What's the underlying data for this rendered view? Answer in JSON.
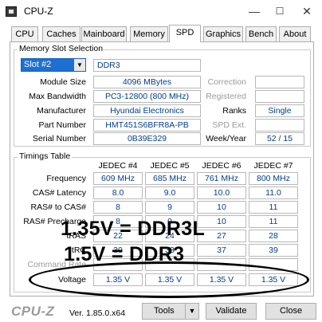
{
  "window": {
    "title": "CPU-Z",
    "minimize_glyph": "—",
    "maximize_glyph": "☐",
    "close_glyph": "✕"
  },
  "tabs": [
    {
      "label": "CPU"
    },
    {
      "label": "Caches"
    },
    {
      "label": "Mainboard"
    },
    {
      "label": "Memory"
    },
    {
      "label": "SPD",
      "active": true
    },
    {
      "label": "Graphics"
    },
    {
      "label": "Bench"
    },
    {
      "label": "About"
    }
  ],
  "slot": {
    "group_label": "Memory Slot Selection",
    "selected": "Slot #2",
    "type": "DDR3",
    "module_size_label": "Module Size",
    "module_size": "4096 MBytes",
    "max_bandwidth_label": "Max Bandwidth",
    "max_bandwidth": "PC3-12800 (800 MHz)",
    "manufacturer_label": "Manufacturer",
    "manufacturer": "Hyundai Electronics",
    "part_number_label": "Part Number",
    "part_number": "HMT451S6BFR8A-PB",
    "serial_number_label": "Serial Number",
    "serial_number": "0B39E329",
    "correction_label": "Correction",
    "correction": "",
    "registered_label": "Registered",
    "registered": "",
    "ranks_label": "Ranks",
    "ranks": "Single",
    "spd_ext_label": "SPD Ext.",
    "spd_ext": "",
    "week_year_label": "Week/Year",
    "week_year": "52 / 15"
  },
  "timings": {
    "group_label": "Timings Table",
    "columns": [
      "JEDEC #4",
      "JEDEC #5",
      "JEDEC #6",
      "JEDEC #7"
    ],
    "rows": [
      {
        "label": "Frequency",
        "values": [
          "609 MHz",
          "685 MHz",
          "761 MHz",
          "800 MHz"
        ]
      },
      {
        "label": "CAS# Latency",
        "values": [
          "8.0",
          "9.0",
          "10.0",
          "11.0"
        ]
      },
      {
        "label": "RAS# to CAS#",
        "values": [
          "8",
          "9",
          "10",
          "11"
        ]
      },
      {
        "label": "RAS# Precharge",
        "values": [
          "8",
          "9",
          "10",
          "11"
        ]
      },
      {
        "label": "tRAS",
        "values": [
          "22",
          "24",
          "27",
          "28"
        ]
      },
      {
        "label": "tRC",
        "values": [
          "30",
          "33",
          "37",
          "39"
        ]
      },
      {
        "label": "Command Rate",
        "values": [
          "",
          "",
          "",
          ""
        ]
      },
      {
        "label": "Voltage",
        "values": [
          "1.35 V",
          "1.35 V",
          "1.35 V",
          "1.35 V"
        ]
      }
    ]
  },
  "annotations": {
    "line1": "1.35V = DDR3L",
    "line2": "1.5V = DDR3"
  },
  "footer": {
    "logo": "CPU-Z",
    "version": "Ver. 1.85.0.x64",
    "tools_label": "Tools",
    "validate_label": "Validate",
    "close_label": "Close"
  }
}
